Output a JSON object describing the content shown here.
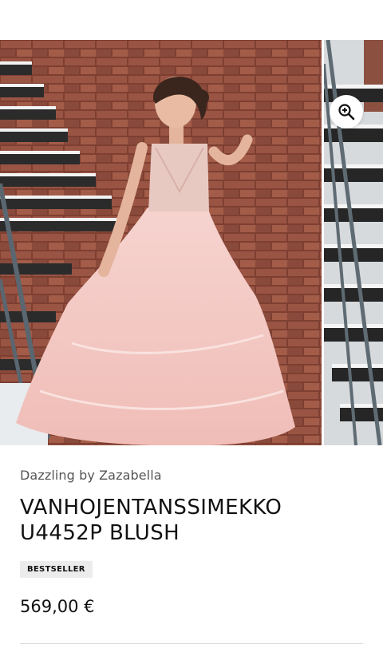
{
  "gallery": {
    "image_alt": "Vaaleanpunainen prinsessamekko kuvattuna tiiliseinää ja portaita vasten",
    "zoom_icon": "zoom-in-icon"
  },
  "product": {
    "brand": "Dazzling by Zazabella",
    "title_line1": "VANHOJENTANSSIMEKKO",
    "title_line2": "U4452P BLUSH",
    "badge": "BESTSELLER",
    "price": "569,00 €"
  },
  "colors": {
    "dress": "#f4c8c4",
    "brick": "#8c4a3a",
    "stairs": "#2a2a2a"
  }
}
